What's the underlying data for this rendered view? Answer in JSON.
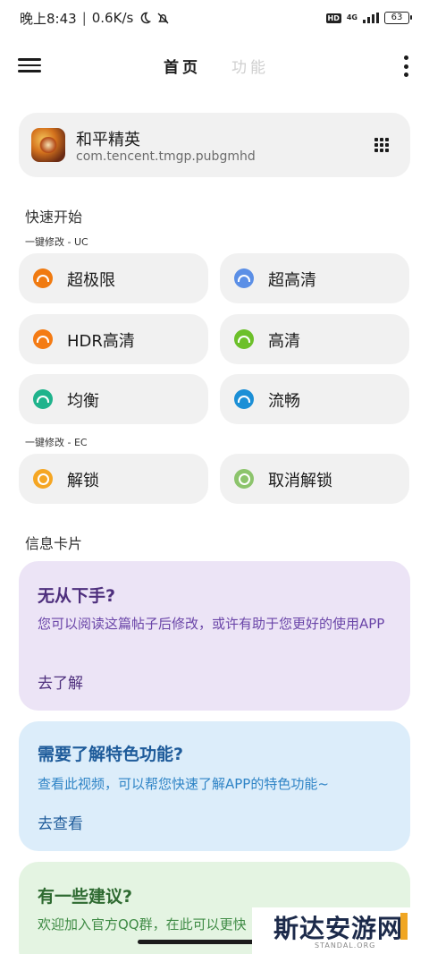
{
  "status_bar": {
    "time": "晚上8:43",
    "speed": "0.6K/s",
    "hd": "HD",
    "network": "4G",
    "battery": "63"
  },
  "app_bar": {
    "tab_home": "首页",
    "tab_function": "功能"
  },
  "app_card": {
    "name": "和平精英",
    "package": "com.tencent.tmgp.pubgmhd"
  },
  "quick_start": {
    "title": "快速开始",
    "uc_label": "一键修改 - UC",
    "uc_options": [
      {
        "label": "超极限",
        "color": "#f07a10"
      },
      {
        "label": "超高清",
        "color": "#5b8fe6"
      },
      {
        "label": "HDR高清",
        "color": "#f47b14"
      },
      {
        "label": "高清",
        "color": "#6cc02a"
      },
      {
        "label": "均衡",
        "color": "#1fb38c"
      },
      {
        "label": "流畅",
        "color": "#1b8fd6"
      }
    ],
    "ec_label": "一键修改 - EC",
    "ec_options": [
      {
        "label": "解锁",
        "color": "#f5a623"
      },
      {
        "label": "取消解锁",
        "color": "#8cc46c"
      }
    ]
  },
  "info": {
    "title": "信息卡片",
    "cards": [
      {
        "title": "无从下手?",
        "body": "您可以阅读这篇帖子后修改，或许有助于您更好的使用APP",
        "link": "去了解"
      },
      {
        "title": "需要了解特色功能?",
        "body": "查看此视频，可以帮您快速了解APP的特色功能~",
        "link": "去查看"
      },
      {
        "title": "有一些建议?",
        "body": "欢迎加入官方QQ群，在此可以更快"
      }
    ]
  },
  "watermark": {
    "name": "斯达安游网",
    "domain": "STANDAL.ORG"
  }
}
